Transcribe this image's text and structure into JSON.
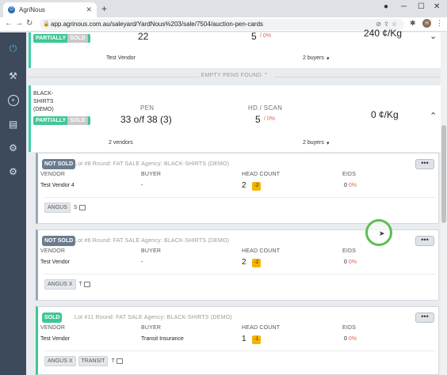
{
  "browser": {
    "tab_title": "AgriNous",
    "url": "app.agrinous.com.au/saleyard/YardNous%203/sale/7504/auction-pen-cards",
    "profile_initial": "H"
  },
  "pen_top": {
    "status_left": "PARTIALLY",
    "status_right": "SOLD",
    "pen_value": "22",
    "hd_scan": "5",
    "hd_scan_pct": "/ 0%",
    "price": "240 ¢/Kg",
    "vendor_summary": "Test Vendor",
    "buyers_summary": "2 buyers"
  },
  "divider": {
    "label": "EMPTY PENS FOUND"
  },
  "pen_main": {
    "agency_line1": "BLACK-",
    "agency_line2": "SHIRTS",
    "agency_line3": "(DEMO)",
    "status_left": "PARTIALLY",
    "status_right": "SOLD",
    "pen_label": "PEN",
    "pen_value": "33 o/f 38 (3)",
    "hd_label": "HD / SCAN",
    "hd_value": "5",
    "hd_pct": "/ 0%",
    "price": "0 ¢/Kg",
    "vendors_summary": "2 vendors",
    "buyers_summary": "2 buyers"
  },
  "columns": {
    "vendor": "VENDOR",
    "buyer": "BUYER",
    "head_count": "HEAD COUNT",
    "eids": "EIDS"
  },
  "lots": [
    {
      "status": "NOT SOLD",
      "meta": "Lot #8  Round: FAT SALE  Agency: BLACK-SHIRTS (DEMO)",
      "vendor": "Test Vendor 4",
      "buyer": "-",
      "head_count": "2",
      "hc_badge": "-2",
      "eids_count": "0",
      "eids_pct": "0%",
      "tags": [
        "ANGUS"
      ],
      "plain_tag": "S"
    },
    {
      "status": "NOT SOLD",
      "meta": "Lot #6  Round: FAT SALE  Agency: BLACK-SHIRTS (DEMO)",
      "vendor": "Test Vendor",
      "buyer": "-",
      "head_count": "2",
      "hc_badge": "-2",
      "eids_count": "0",
      "eids_pct": "0%",
      "tags": [
        "ANGUS X"
      ],
      "plain_tag": "T"
    },
    {
      "status": "SOLD",
      "meta": "Lot #11  Round: FAT SALE  Agency: BLACK-SHIRTS (DEMO)",
      "vendor": "Test Vendor",
      "buyer": "Transit Insurance",
      "head_count": "1",
      "hc_badge": "-1",
      "eids_count": "0",
      "eids_pct": "0%",
      "tags": [
        "ANGUS X",
        "TRANSIT"
      ],
      "plain_tag": "T"
    }
  ],
  "more_label": "•••",
  "colors": {
    "sidebar": "#3d4a5c",
    "accent_green": "#3ec794",
    "not_sold": "#6c7c8f",
    "warning": "#f5b400",
    "danger_text": "#e0624f"
  }
}
